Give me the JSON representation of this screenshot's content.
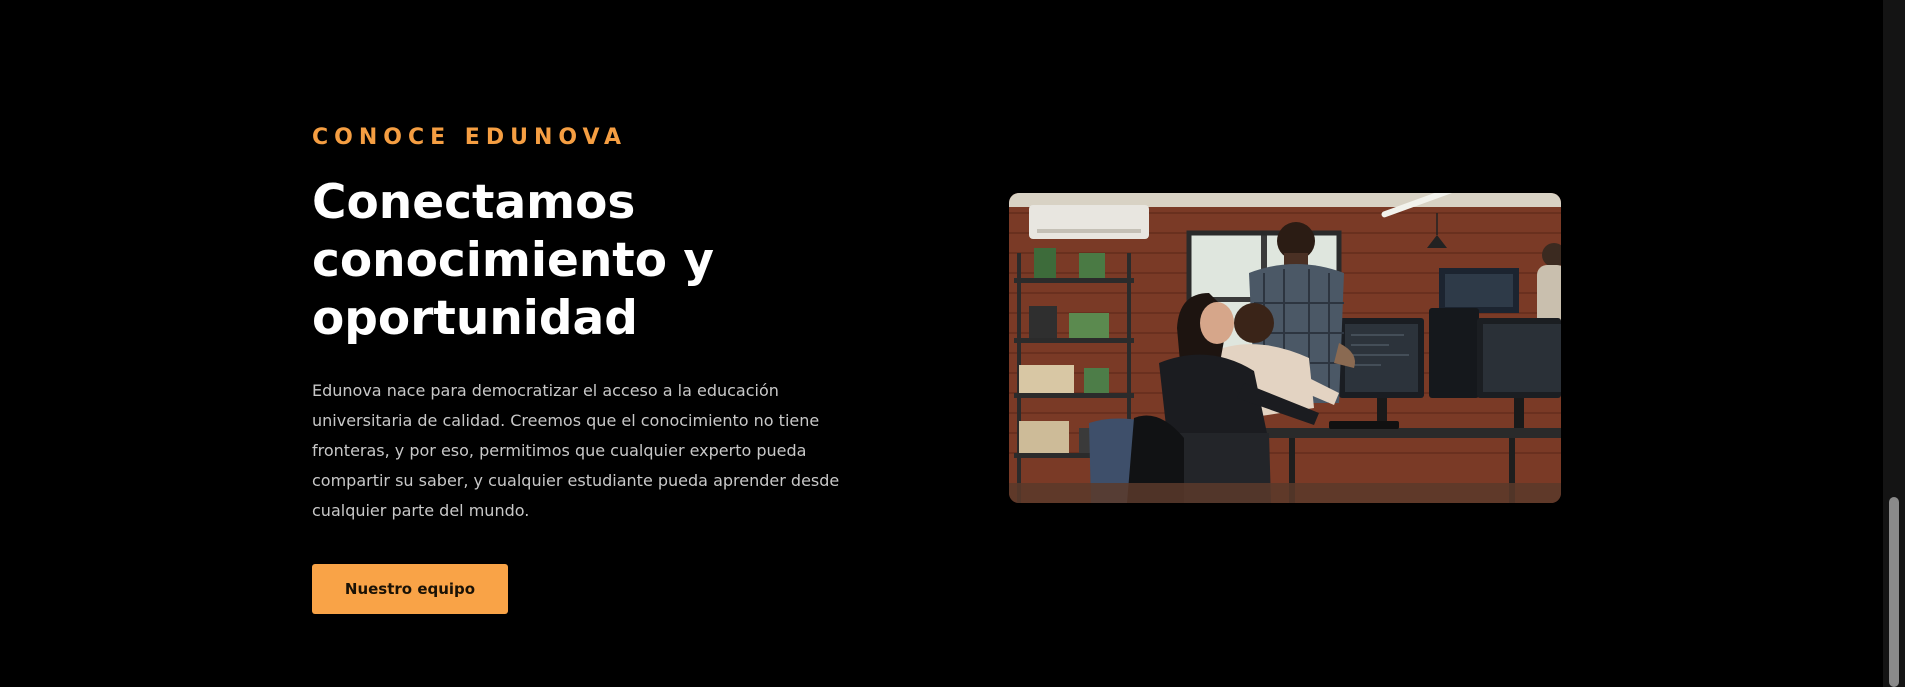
{
  "section": {
    "eyebrow": "CONOCE EDUNOVA",
    "heading": "Conectamos conocimiento y oportunidad",
    "description": "Edunova nace para democratizar el acceso a la educación universitaria de calidad. Creemos que el conocimiento no tiene fronteras, y por eso, permitimos que cualquier experto pueda compartir su saber, y cualquier estudiante pueda aprender desde cualquier parte del mundo.",
    "cta_label": "Nuestro equipo"
  },
  "colors": {
    "background": "#000000",
    "accent": "#f59e42",
    "button": "#f9a347",
    "heading": "#ffffff",
    "body_text": "#c8c8c8"
  },
  "image": {
    "icon": "office-team-photo"
  }
}
